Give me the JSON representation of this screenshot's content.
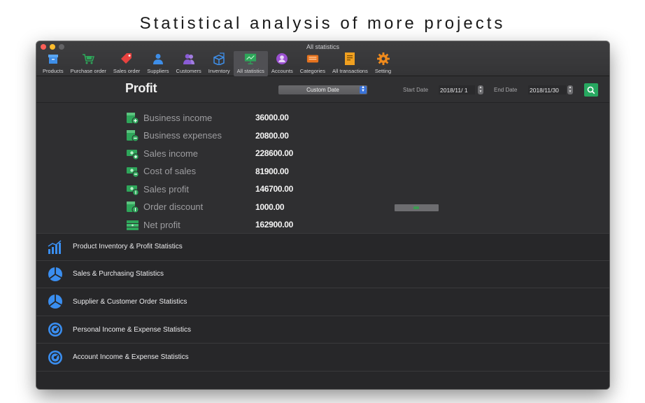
{
  "headline": "Statistical analysis of more projects",
  "window": {
    "title": "All statistics"
  },
  "toolbar": [
    {
      "label": "Products",
      "icon": "box-icon",
      "color": "#3e8ee8"
    },
    {
      "label": "Purchase order",
      "icon": "cart-icon",
      "color": "#2ea65a"
    },
    {
      "label": "Sales order",
      "icon": "tag-icon",
      "color": "#e8423f"
    },
    {
      "label": "Suppliers",
      "icon": "person-icon",
      "color": "#3e8ee8"
    },
    {
      "label": "Customers",
      "icon": "people-icon",
      "color": "#8a5cd6"
    },
    {
      "label": "Inventory",
      "icon": "boxes-icon",
      "color": "#3e8ee8"
    },
    {
      "label": "All statistics",
      "icon": "presentation-icon",
      "color": "#2ea65a"
    },
    {
      "label": "Accounts",
      "icon": "account-icon",
      "color": "#9a4fd0"
    },
    {
      "label": "Categories",
      "icon": "categories-icon",
      "color": "#e8741f"
    },
    {
      "label": "All transactions",
      "icon": "receipt-icon",
      "color": "#f0a020"
    },
    {
      "label": "Setting",
      "icon": "gear-icon",
      "color": "#f08a1c"
    }
  ],
  "header": {
    "title": "Profit",
    "date_mode": "Custom Date",
    "start_label": "Start Date",
    "start_value": "2018/11/  1",
    "end_label": "End Date",
    "end_value": "2018/11/30"
  },
  "stats": [
    {
      "label": "Business income",
      "value": "36000.00",
      "icon": "wallet-plus-icon"
    },
    {
      "label": "Business expenses",
      "value": "20800.00",
      "icon": "wallet-minus-icon"
    },
    {
      "label": "Sales income",
      "value": "228600.00",
      "icon": "cash-plus-icon"
    },
    {
      "label": "Cost of sales",
      "value": "81900.00",
      "icon": "cash-minus-icon"
    },
    {
      "label": "Sales profit",
      "value": "146700.00",
      "icon": "cash-dollar-icon"
    },
    {
      "label": "Order discount",
      "value": "1000.00",
      "icon": "wallet-dollar-icon"
    },
    {
      "label": "Net profit",
      "value": "162900.00",
      "icon": "money-stack-icon"
    }
  ],
  "list": [
    {
      "label": "Product Inventory & Profit Statistics",
      "icon": "bar-chart-icon"
    },
    {
      "label": "Sales & Purchasing Statistics",
      "icon": "pie-chart-icon"
    },
    {
      "label": "Supplier & Customer Order Statistics",
      "icon": "pie-chart-icon"
    },
    {
      "label": "Personal Income & Expense Statistics",
      "icon": "gauge-icon"
    },
    {
      "label": "Account Income & Expense Statistics",
      "icon": "gauge-icon"
    }
  ],
  "colors": {
    "accent_green": "#27a860",
    "list_icon_blue": "#3a8ef0"
  }
}
